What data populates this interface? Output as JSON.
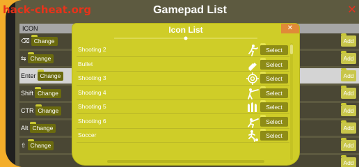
{
  "watermark": "hack-cheat.org",
  "gamepad": {
    "title": "Gamepad List",
    "close_glyph": "✕",
    "header_label": "ICON",
    "rows": [
      {
        "key": "⌫",
        "change": "Change",
        "add": "Add",
        "highlighted": false
      },
      {
        "key": "⇆",
        "change": "Change",
        "add": "Add",
        "highlighted": false
      },
      {
        "key": "Enter",
        "change": "Change",
        "add": "Add",
        "highlighted": true
      },
      {
        "key": "Shift",
        "change": "Change",
        "add": "Add",
        "highlighted": false
      },
      {
        "key": "CTR",
        "change": "Change",
        "add": "Add",
        "highlighted": false
      },
      {
        "key": "Alt",
        "change": "Change",
        "add": "Add",
        "highlighted": false
      },
      {
        "key": "⇧",
        "change": "Change",
        "add": "Add",
        "highlighted": false
      },
      {
        "key": "",
        "change": "",
        "add": "Add",
        "highlighted": false
      }
    ]
  },
  "icon_list": {
    "title": "Icon List",
    "close_glyph": "✕",
    "items": [
      {
        "name": "Shooting 2",
        "icon": "running-shooter-icon",
        "select": "Select"
      },
      {
        "name": "Bullet",
        "icon": "bullet-icon",
        "select": "Select"
      },
      {
        "name": "Shooting 3",
        "icon": "crosshair-icon",
        "select": "Select"
      },
      {
        "name": "Shooting 4",
        "icon": "aiming-shooter-icon",
        "select": "Select"
      },
      {
        "name": "Shooting 5",
        "icon": "ammo-icon",
        "select": "Select"
      },
      {
        "name": "Shooting 6",
        "icon": "crouching-shooter-icon",
        "select": "Select"
      },
      {
        "name": "Soccer",
        "icon": "soccer-player-icon",
        "select": "Select"
      }
    ]
  },
  "colors": {
    "outer_frame": "#f3ad2a",
    "panel_bg": "#cfcd28",
    "select_button": "#8e8c16",
    "watermark": "#e8331a"
  }
}
